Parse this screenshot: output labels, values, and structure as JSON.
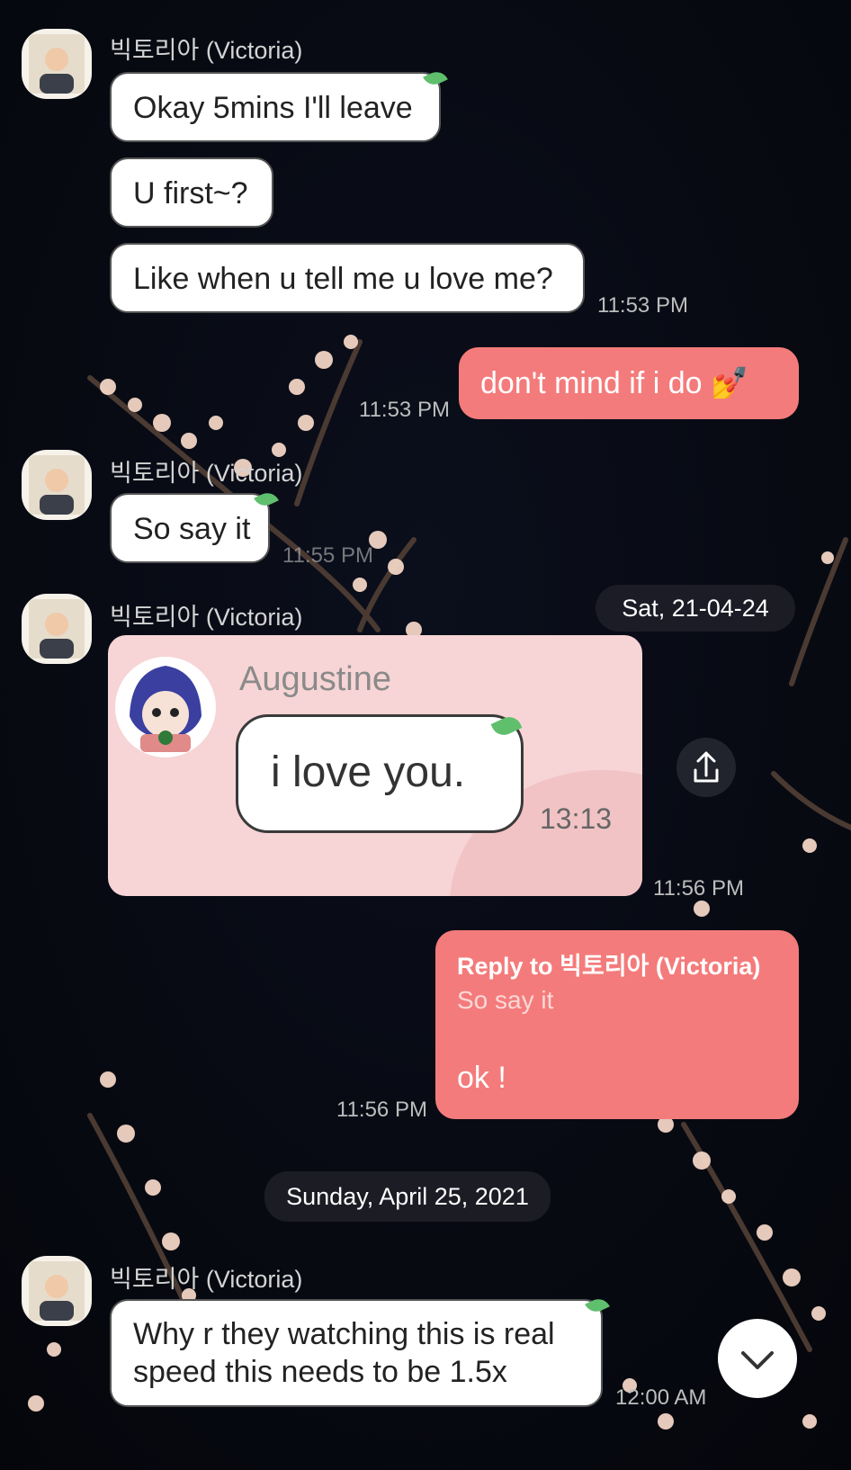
{
  "messages": {
    "m1": {
      "sender": "빅토리아 (Victoria)",
      "text": "Okay 5mins I'll leave"
    },
    "m2": {
      "text": "U first~?"
    },
    "m3": {
      "text": "Like when u tell me u love me?",
      "time": "11:53 PM"
    },
    "m4": {
      "text": "don't mind if i do",
      "emoji": "💅",
      "time": "11:53 PM"
    },
    "m5": {
      "sender": "빅토리아 (Victoria)",
      "text": "So say it",
      "time": "11:55 PM"
    },
    "m6": {
      "sender": "빅토리아 (Victoria)",
      "image": {
        "name": "Augustine",
        "text": "i love you.",
        "time": "13:13"
      },
      "time": "11:56 PM"
    },
    "m7": {
      "reply_label": "Reply to 빅토리아 (Victoria)",
      "reply_quote": "So say it",
      "text": "ok !",
      "time": "11:56 PM"
    },
    "m8": {
      "sender": "빅토리아 (Victoria)",
      "line1": "Why r they watching this is real",
      "line2": "speed this needs to be 1.5x",
      "time": "12:00 AM"
    }
  },
  "date_pills": {
    "floating": "Sat, 21-04-24",
    "divider": "Sunday, April 25, 2021"
  },
  "icons": {
    "share": "share-icon",
    "scroll_down": "chevron-down-icon"
  },
  "colors": {
    "outgoing": "#f47b7b",
    "incoming": "#ffffff",
    "background": "#06080f",
    "leaf": "#5fbf6d",
    "quote_card": "#f7d4d5"
  }
}
